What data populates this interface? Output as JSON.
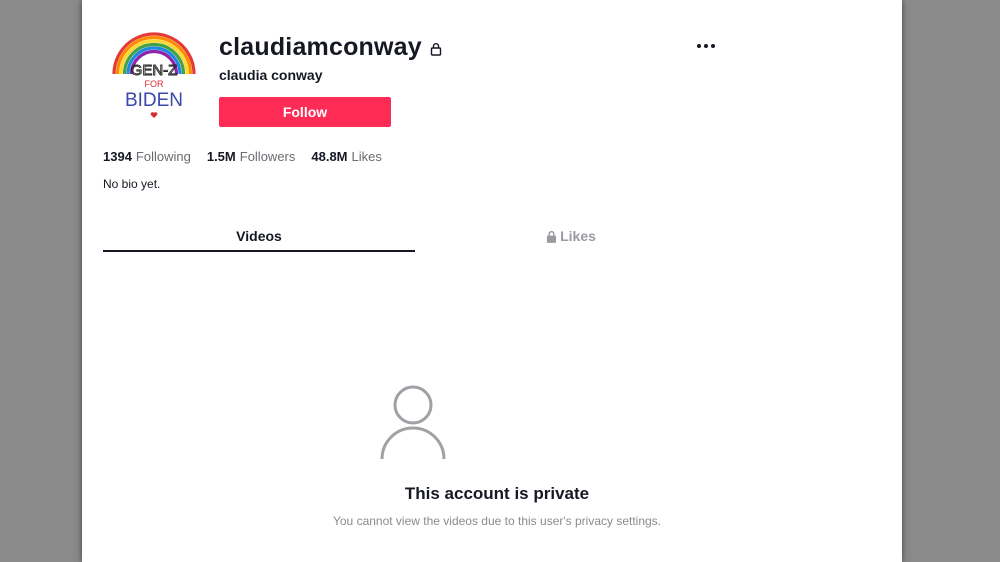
{
  "profile": {
    "username": "claudiamconway",
    "display_name": "claudia conway",
    "follow_label": "Follow",
    "bio": "No bio yet.",
    "avatar_text": {
      "line1": "GEN-Z",
      "line2": "FOR",
      "line3": "BIDEN"
    }
  },
  "stats": [
    {
      "value": "1394",
      "label": "Following"
    },
    {
      "value": "1.5M",
      "label": "Followers"
    },
    {
      "value": "48.8M",
      "label": "Likes"
    }
  ],
  "tabs": [
    {
      "label": "Videos",
      "active": true
    },
    {
      "label": "Likes",
      "active": false,
      "icon": "lock-icon"
    }
  ],
  "private_notice": {
    "title": "This account is private",
    "subtitle": "You cannot view the videos due to this user's privacy settings."
  },
  "colors": {
    "accent": "#fe2c55",
    "text": "#161823",
    "muted": "#8a8b91"
  }
}
